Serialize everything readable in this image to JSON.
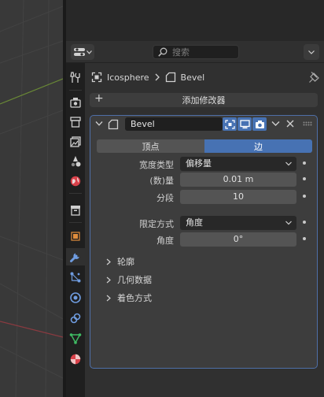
{
  "colors": {
    "accent": "#4772b3",
    "panel_bg": "#303030",
    "outline": "#4e6fa8"
  },
  "search": {
    "placeholder": "搜索"
  },
  "breadcrumb": {
    "object": "Icosphere",
    "modifier": "Bevel"
  },
  "add_modifier": {
    "label": "添加修改器"
  },
  "modifier": {
    "name": "Bevel",
    "mode_tabs": {
      "vertices": "顶点",
      "edges": "边",
      "selected": "边"
    },
    "fields": {
      "width_type": {
        "label": "宽度类型",
        "value": "偏移量"
      },
      "amount": {
        "label": "(数)量",
        "value": "0.01 m"
      },
      "segments": {
        "label": "分段",
        "value": "10"
      },
      "limit_method": {
        "label": "限定方式",
        "value": "角度"
      },
      "angle": {
        "label": "角度",
        "value": "0°"
      }
    },
    "subpanels": [
      "轮廓",
      "几何数据",
      "着色方式"
    ]
  },
  "tabs": [
    "tool-icon",
    "render-icon",
    "output-icon",
    "view-layer-icon",
    "scene-icon",
    "world-icon",
    "collection-icon",
    "object-icon",
    "modifier-icon",
    "particles-icon",
    "physics-icon",
    "constraints-icon",
    "data-icon",
    "material-icon"
  ]
}
